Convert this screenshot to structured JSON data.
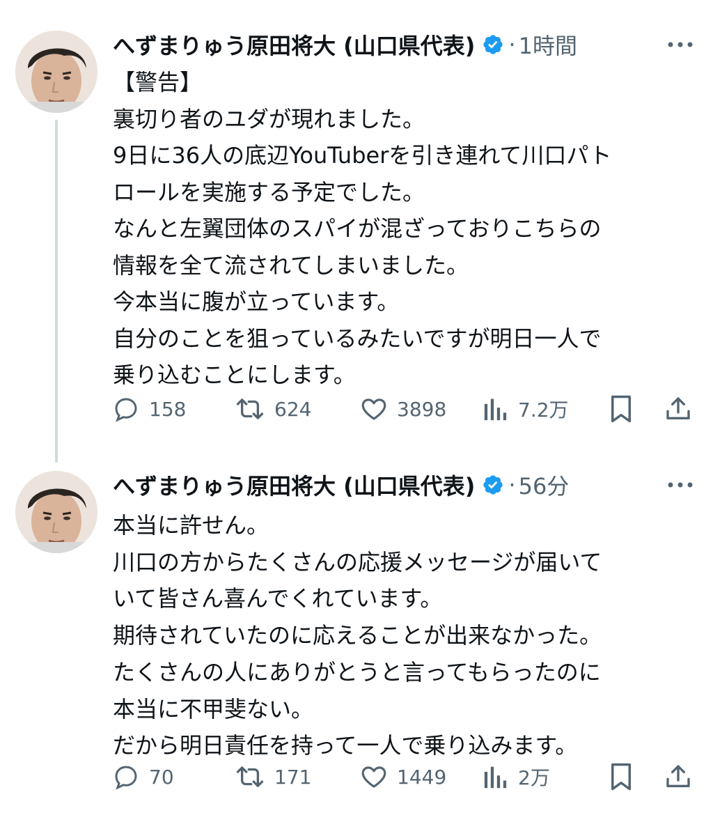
{
  "colors": {
    "text": "#0f1419",
    "secondary": "#536471",
    "verified": "#1d9bf0",
    "thread_line": "#cfd9de",
    "background": "#ffffff"
  },
  "tweets": [
    {
      "author_name": "へずまりゅう原田将大 (山口県代表)",
      "verified_icon": "verified-badge-icon",
      "separator": "·",
      "time": "1時間",
      "body": "【警告】\n裏切り者のユダが現れました。\n9日に36人の底辺YouTuberを引き連れて川口パト\nロールを実施する予定でした。\nなんと左翼団体のスパイが混ざっておりこちらの\n情報を全て流されてしまいました。\n今本当に腹が立っています。\n自分のことを狙っているみたいですが明日一人で\n乗り込むことにします。",
      "replies": "158",
      "retweets": "624",
      "likes": "3898",
      "views": "7.2万"
    },
    {
      "author_name": "へずまりゅう原田将大 (山口県代表)",
      "verified_icon": "verified-badge-icon",
      "separator": "·",
      "time": "56分",
      "body": "本当に許せん。\n川口の方からたくさんの応援メッセージが届いて\nいて皆さん喜んでくれています。\n期待されていたのに応えることが出来なかった。\nたくさんの人にありがとうと言ってもらったのに\n本当に不甲斐ない。\nだから明日責任を持って一人で乗り込みます。",
      "replies": "70",
      "retweets": "171",
      "likes": "1449",
      "views": "2万"
    }
  ]
}
